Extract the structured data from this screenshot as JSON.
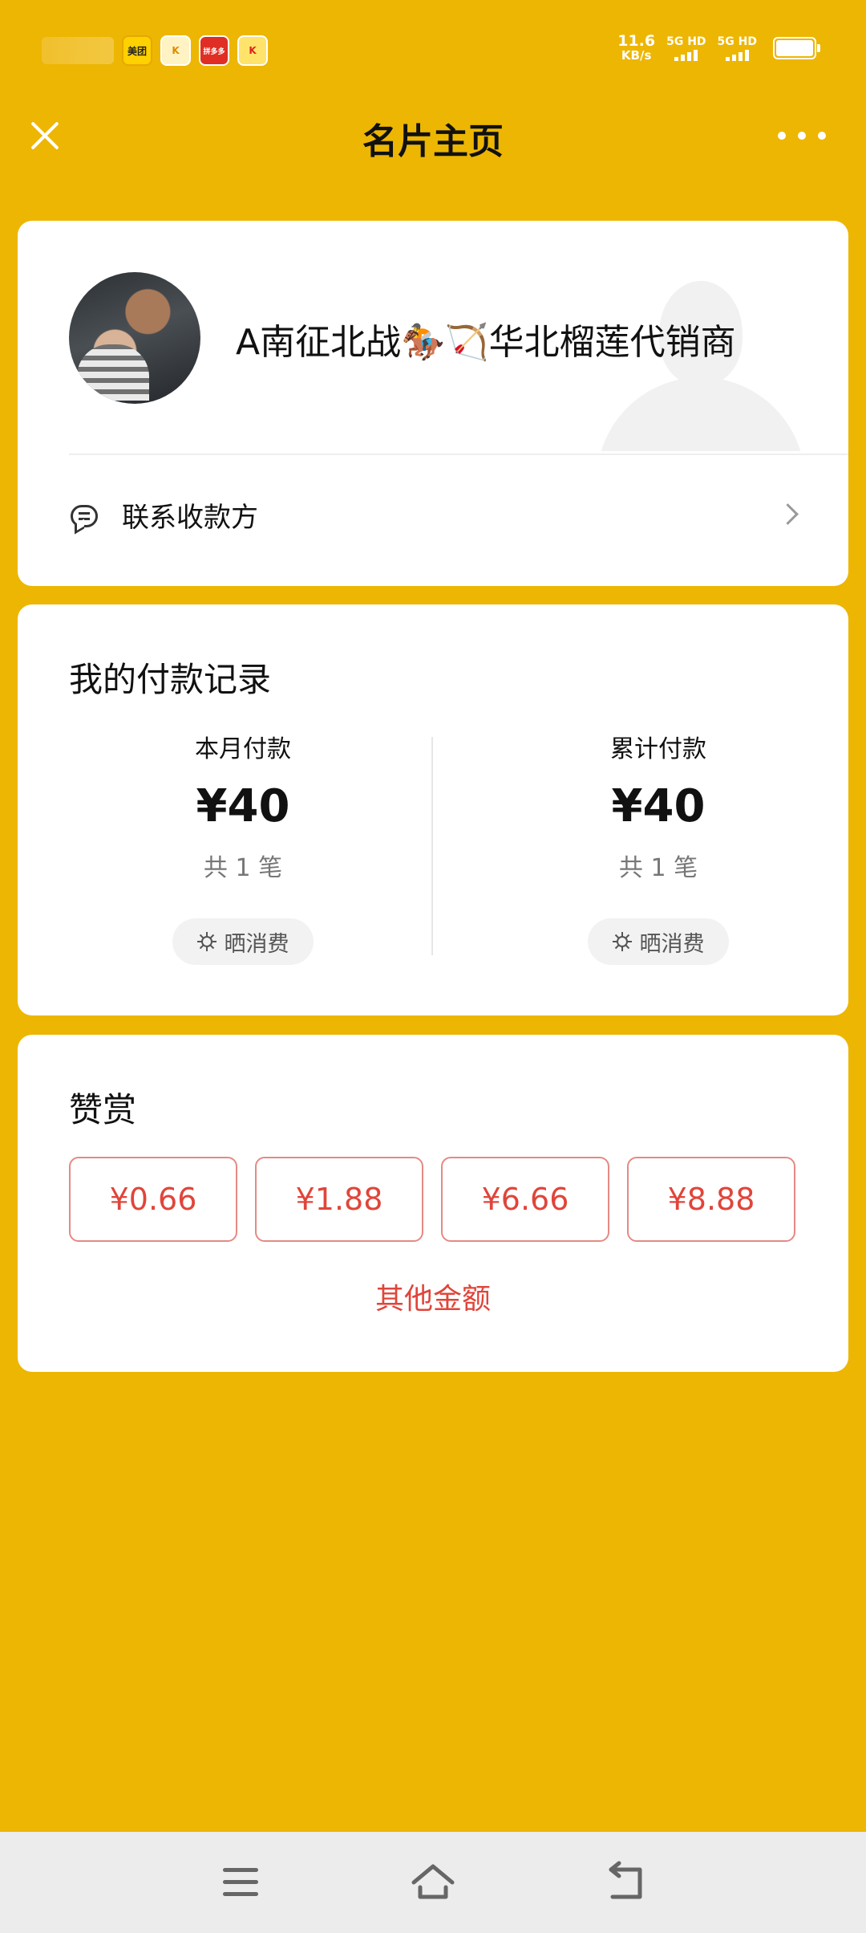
{
  "status_bar": {
    "notification_icons": [
      "美团",
      "K",
      "拼多多",
      "K"
    ],
    "net_speed_value": "11.6",
    "net_speed_unit": "KB/s",
    "sim1_label": "5G HD",
    "sim2_label": "5G HD",
    "battery_level": 1.0
  },
  "header": {
    "title": "名片主页",
    "close_icon": "close-icon",
    "more_icon": "more-icon"
  },
  "profile": {
    "name": "A南征北战🏇🏹华北榴莲代销商",
    "contact_label": "联系收款方"
  },
  "records": {
    "title": "我的付款记录",
    "month": {
      "label": "本月付款",
      "amount": "¥40",
      "count": "共 1 笔",
      "share_label": "晒消费"
    },
    "total": {
      "label": "累计付款",
      "amount": "¥40",
      "count": "共 1 笔",
      "share_label": "晒消费"
    }
  },
  "reward": {
    "title": "赞赏",
    "amounts": [
      "¥0.66",
      "¥1.88",
      "¥6.66",
      "¥8.88"
    ],
    "other_label": "其他金额"
  },
  "nav": {
    "icons": [
      "menu-icon",
      "home-icon",
      "back-icon"
    ]
  },
  "colors": {
    "background": "#EDB602",
    "accent_red": "#E0453A",
    "card": "#FFFFFF"
  }
}
